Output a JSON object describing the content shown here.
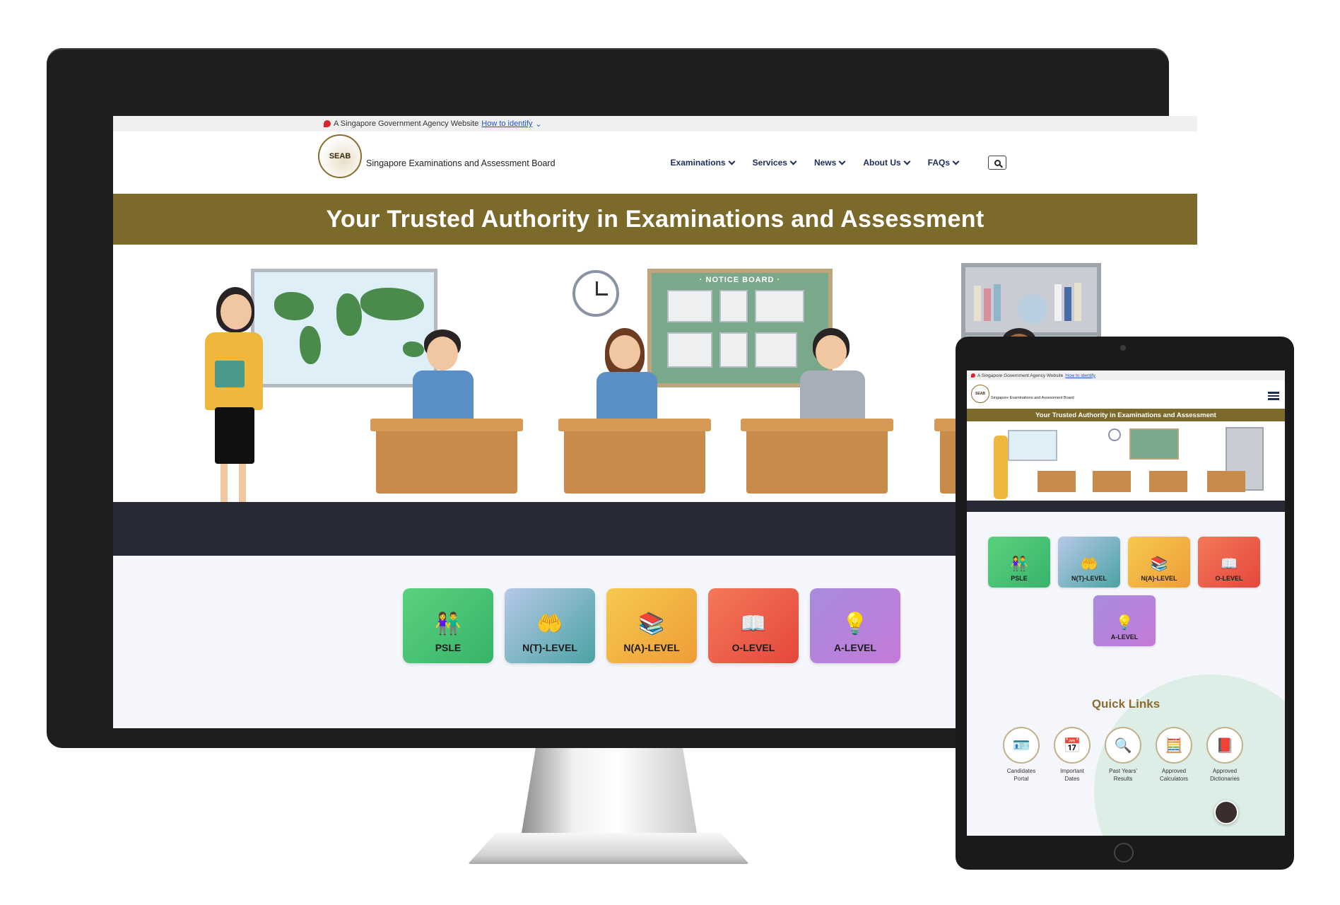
{
  "gov_bar": {
    "text": "A Singapore Government Agency Website",
    "link": "How to identify",
    "chevron": "⌄"
  },
  "logo": {
    "seal_text": "SEAB",
    "name": "Singapore Examinations and Assessment Board"
  },
  "nav": {
    "items": [
      {
        "label": "Examinations"
      },
      {
        "label": "Services"
      },
      {
        "label": "News"
      },
      {
        "label": "About Us"
      },
      {
        "label": "FAQs"
      }
    ],
    "search_icon": "search-icon"
  },
  "banner": {
    "title": "Your Trusted Authority in Examinations and Assessment"
  },
  "hero": {
    "notice_board_title": "· NOTICE BOARD ·"
  },
  "exams": [
    {
      "label": "PSLE",
      "icon": "👫",
      "color": "#37b36b"
    },
    {
      "label": "N(T)-LEVEL",
      "icon": "🤲",
      "color": "#4aa3a4"
    },
    {
      "label": "N(A)-LEVEL",
      "icon": "📚",
      "color": "#ee9d38"
    },
    {
      "label": "O-LEVEL",
      "icon": "📖",
      "color": "#e5473c"
    },
    {
      "label": "A-LEVEL",
      "icon": "💡",
      "color": "#c37ad7"
    }
  ],
  "tablet": {
    "quick_links_title": "Quick Links",
    "quick_links": [
      {
        "label": "Candidates Portal",
        "icon": "🪪"
      },
      {
        "label": "Important Dates",
        "icon": "📅"
      },
      {
        "label": "Past Years' Results",
        "icon": "🔍"
      },
      {
        "label": "Approved Calculators",
        "icon": "🧮"
      },
      {
        "label": "Approved Dictionaries",
        "icon": "📕"
      }
    ]
  },
  "colors": {
    "banner": "#7c6a2b",
    "nav_text": "#1c2c5b",
    "quick_links_title": "#8a6d2e"
  }
}
